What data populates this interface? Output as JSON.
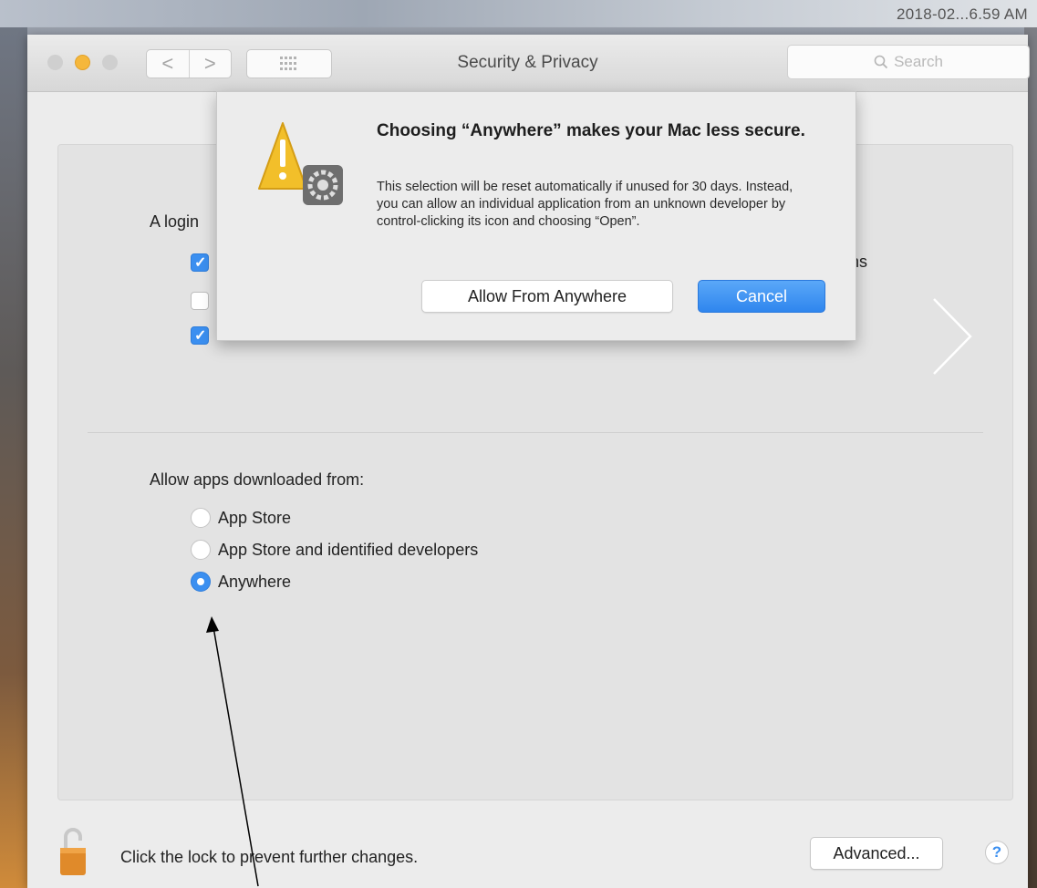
{
  "desktop": {
    "clock": "2018-02...6.59 AM"
  },
  "window": {
    "title": "Security & Privacy",
    "search_placeholder": "Search",
    "nav_back_glyph": "<",
    "nav_forward_glyph": ">"
  },
  "general": {
    "login_label": "A login",
    "partial_row_text": "ns"
  },
  "gatekeeper": {
    "heading": "Allow apps downloaded from:",
    "options": [
      {
        "label": "App Store",
        "selected": false
      },
      {
        "label": "App Store and identified developers",
        "selected": false
      },
      {
        "label": "Anywhere",
        "selected": true
      }
    ]
  },
  "footer": {
    "lock_text": "Click the lock to prevent further changes.",
    "advanced_label": "Advanced...",
    "help_label": "?"
  },
  "alert": {
    "title": "Choosing “Anywhere” makes your Mac less secure.",
    "body": "This selection will be reset automatically if unused for 30 days. Instead, you can allow an individual application from an unknown developer by control-clicking its icon and choosing “Open”.",
    "allow_label": "Allow From Anywhere",
    "cancel_label": "Cancel"
  },
  "colors": {
    "accent": "#3b8ff0",
    "warning": "#f2bf2a",
    "minimize": "#f5b73b"
  },
  "icons": {
    "warning": "warning-triangle-icon",
    "gear": "gear-icon",
    "lock": "lock-open-icon",
    "search": "search-icon",
    "grid": "grid-icon",
    "chevron": "chevron-right-icon"
  }
}
